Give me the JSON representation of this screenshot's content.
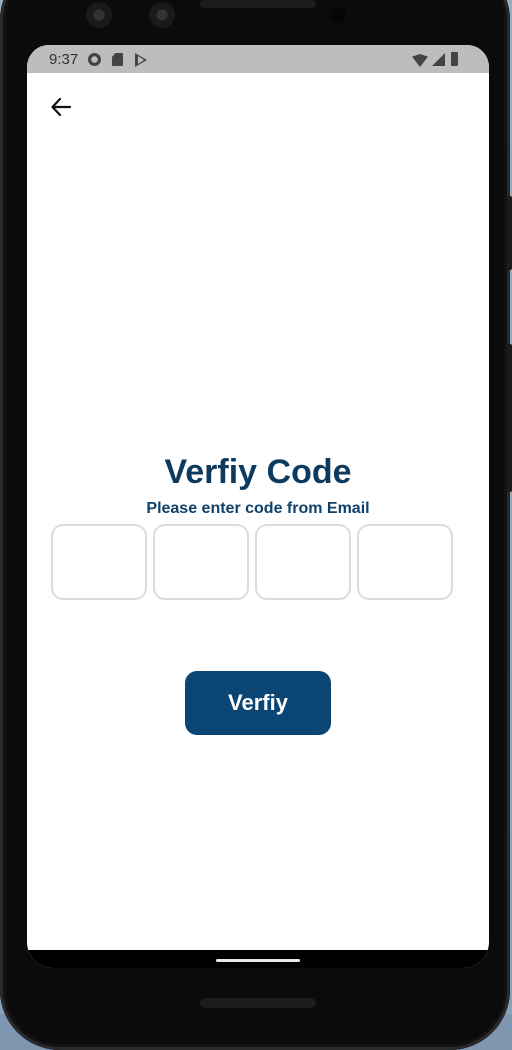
{
  "status_bar": {
    "time": "9:37",
    "left_icons": [
      "gear-icon",
      "sd-card-icon",
      "play-store-icon"
    ],
    "right_icons": [
      "wifi-icon",
      "signal-icon",
      "battery-icon"
    ]
  },
  "header": {
    "back_icon": "arrow-left-icon"
  },
  "main": {
    "title": "Verfiy Code",
    "subtitle": "Please enter code from Email",
    "code_boxes": [
      "",
      "",
      "",
      ""
    ],
    "verify_label": "Verfiy"
  },
  "colors": {
    "primary": "#0a4573",
    "title_text": "#0d3b5f",
    "status_bar": "#bdbdbd",
    "box_border": "#dcdcdc"
  }
}
